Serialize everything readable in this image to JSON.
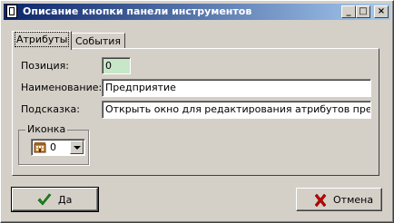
{
  "window": {
    "title": "Описание кнопки панели инструментов"
  },
  "titlebar_buttons": {
    "minimize": "_",
    "maximize": "□",
    "close": "×"
  },
  "tabs": [
    {
      "label": "Атрибуты",
      "active": true
    },
    {
      "label": "События",
      "active": false
    }
  ],
  "form": {
    "position_label": "Позиция:",
    "position_value": "0",
    "name_label": "Наименование:",
    "name_value": "Предприятие",
    "hint_label": "Подсказка:",
    "hint_value": "Открыть окно для редактирования атрибутов предприя"
  },
  "icon_group": {
    "title": "Иконка",
    "selected_value": "0",
    "icon": "building-icon"
  },
  "buttons": {
    "ok_label": "Да",
    "ok_icon": "checkmark-icon",
    "cancel_label": "Отмена",
    "cancel_icon": "x-cross-icon"
  },
  "colors": {
    "title_gradient_start": "#0a246a",
    "title_gradient_end": "#a6caf0",
    "position_field_bg": "#c8e6c8",
    "ok_icon_color": "#1a8a1a",
    "cancel_icon_color": "#c00000"
  }
}
